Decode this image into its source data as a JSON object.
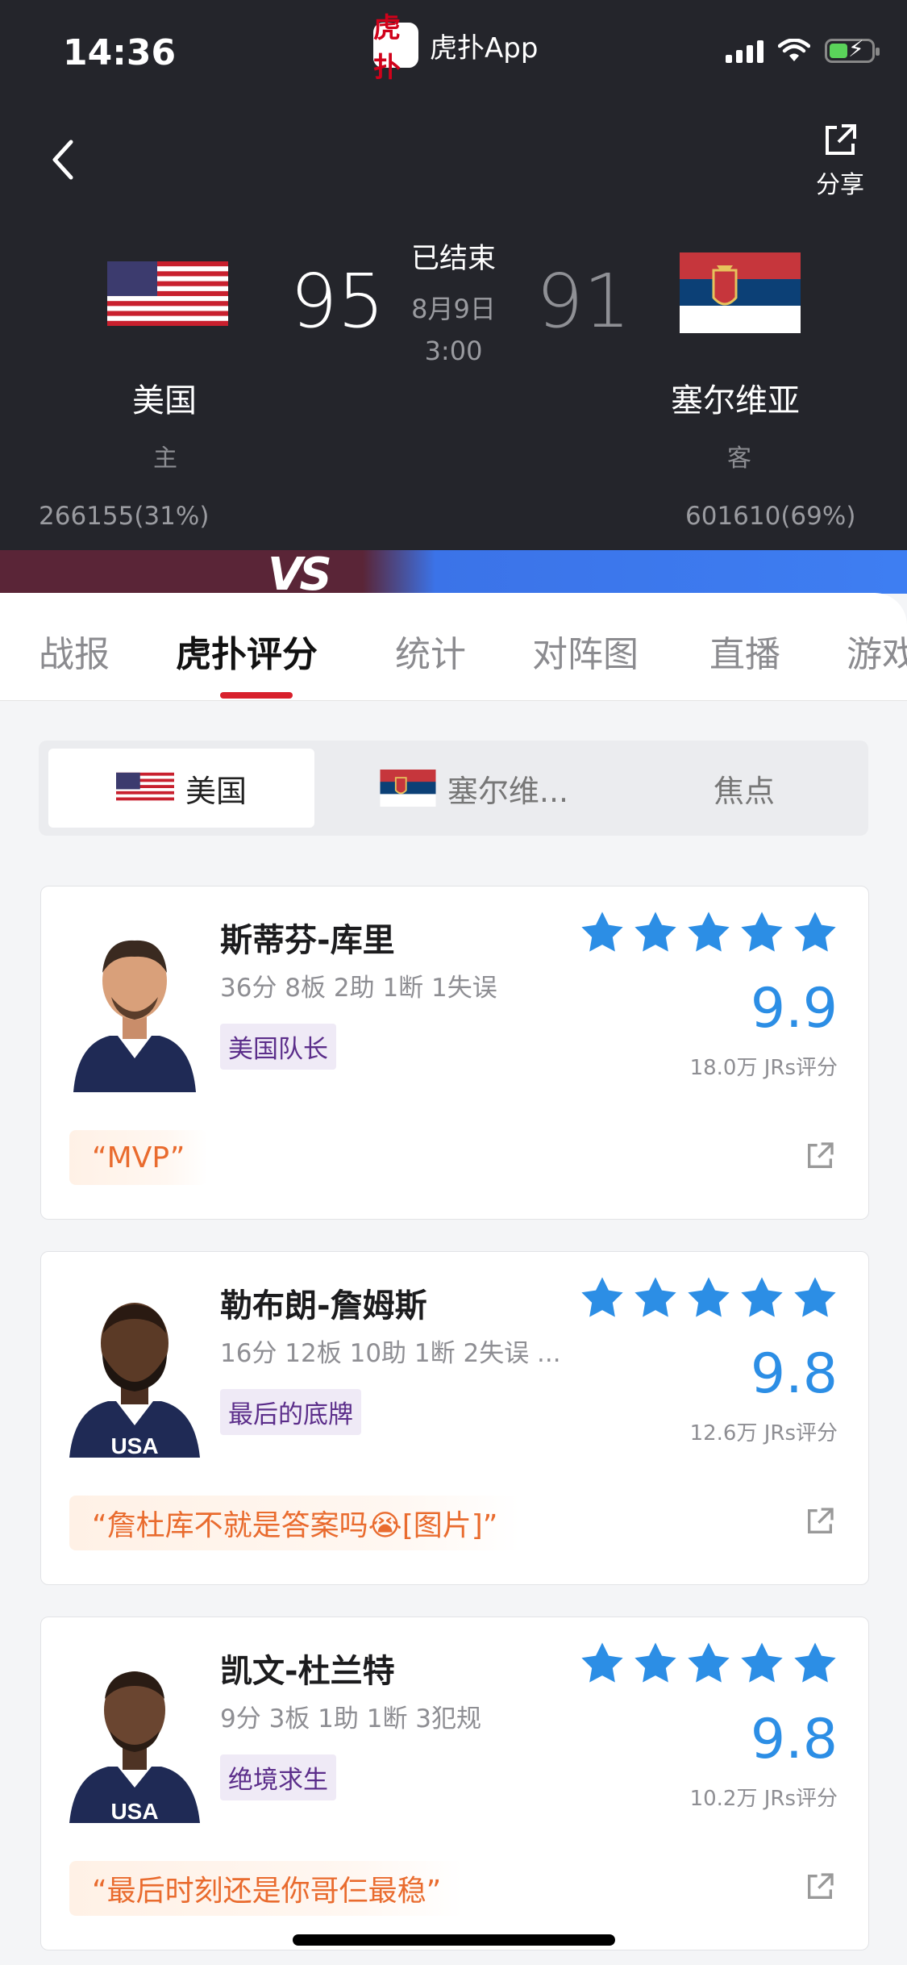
{
  "status_bar": {
    "time": "14:36",
    "app_logo": "虎扑",
    "app_name": "虎扑App"
  },
  "header": {
    "share_label": "分享"
  },
  "match": {
    "home": {
      "name": "美国",
      "role": "主",
      "score": "95",
      "support": "266155(31%)"
    },
    "away": {
      "name": "塞尔维亚",
      "role": "客",
      "score": "91",
      "support": "601610(69%)"
    },
    "status": "已结束",
    "date": "8月9日",
    "time": "3:00",
    "vs": "VS"
  },
  "tabs": [
    "战报",
    "虎扑评分",
    "统计",
    "对阵图",
    "直播",
    "游戏"
  ],
  "team_switch": [
    "美国",
    "塞尔维...",
    "焦点"
  ],
  "players": [
    {
      "name": "斯蒂芬-库里",
      "stats": "36分 8板 2助 1断 1失误",
      "tag": "美国队长",
      "rating": "9.9",
      "votes": "18.0万 JRs评分",
      "quote": "“MVP”"
    },
    {
      "name": "勒布朗-詹姆斯",
      "stats": "16分 12板 10助 1断 2失误 ...",
      "tag": "最后的底牌",
      "rating": "9.8",
      "votes": "12.6万 JRs评分",
      "quote": "“詹杜库不就是答案吗😭[图片]”"
    },
    {
      "name": "凯文-杜兰特",
      "stats": "9分 3板 1助 1断 3犯规",
      "tag": "绝境求生",
      "rating": "9.8",
      "votes": "10.2万 JRs评分",
      "quote": "“最后时刻还是你哥仨最稳”"
    }
  ],
  "colors": {
    "header_bg": "#24252b",
    "accent_red": "#d8202c",
    "rating_blue": "#2c8ee5",
    "quote_orange": "#e96b2e",
    "tag_purple": "#5b2d8a"
  }
}
